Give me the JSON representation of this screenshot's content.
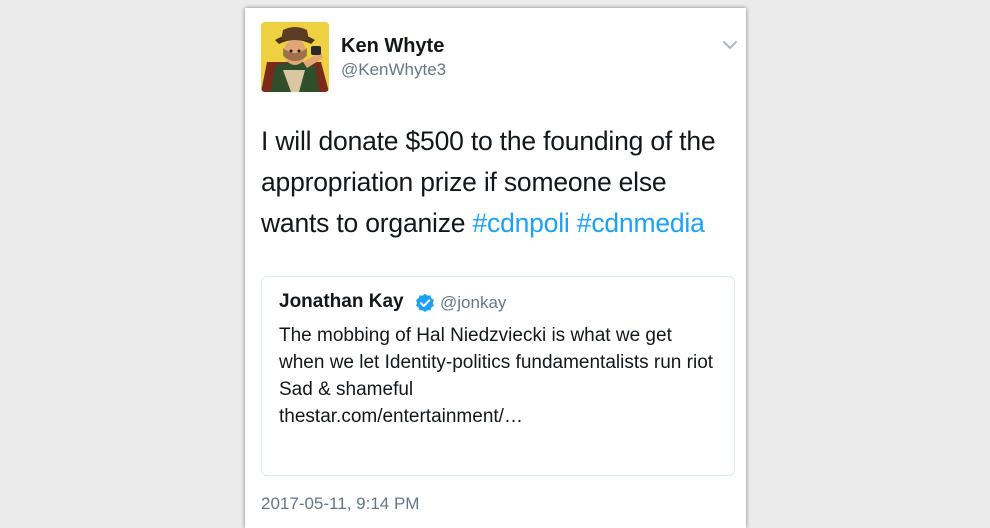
{
  "tweet": {
    "author": {
      "display_name": "Ken Whyte",
      "handle": "@KenWhyte3"
    },
    "text": "I will donate $500 to the founding of the appropriation prize if someone else wants to organize",
    "hashtags": [
      "#cdnpoli",
      "#cdnmedia"
    ],
    "timestamp": "2017-05-11, 9:14 PM"
  },
  "quoted_tweet": {
    "author": {
      "display_name": "Jonathan Kay",
      "handle": "@jonkay",
      "verified": true
    },
    "text": "The mobbing of Hal Niedzviecki is what we get when we let Identity-politics fundamentalists run riot\nSad  & shameful\nthestar.com/entertainment/…"
  },
  "icons": {
    "avatar": "avatar-image",
    "menu": "chevron-down-icon",
    "verified": "verified-badge-icon"
  },
  "colors": {
    "background": "#ebebeb",
    "card": "#ffffff",
    "text": "#14171a",
    "secondary_text": "#657786",
    "link": "#1da1f2",
    "border": "#e1e8ed"
  }
}
